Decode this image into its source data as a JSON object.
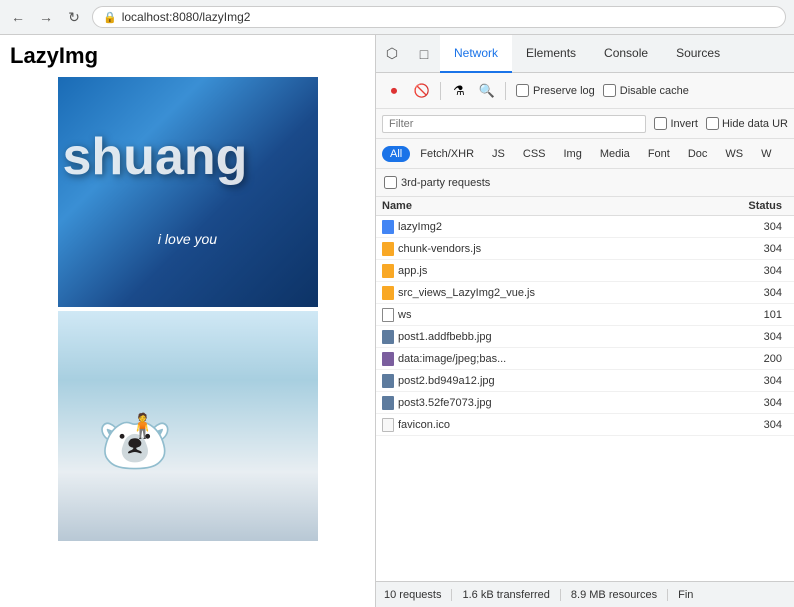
{
  "browser": {
    "back_label": "←",
    "forward_label": "→",
    "reload_label": "↻",
    "address": "localhost:8080/lazyImg2",
    "lock_icon": "🔒"
  },
  "page": {
    "title": "LazyImg",
    "img1_text": "shuang",
    "img1_sub": "i love you"
  },
  "devtools": {
    "tabs": [
      {
        "label": "Network",
        "active": true
      },
      {
        "label": "Elements",
        "active": false
      },
      {
        "label": "Console",
        "active": false
      },
      {
        "label": "Sources",
        "active": false
      }
    ],
    "toolbar": {
      "preserve_log_label": "Preserve log",
      "disable_cache_label": "Disable cache"
    },
    "filter": {
      "placeholder": "Filter",
      "invert_label": "Invert",
      "hide_data_url_label": "Hide data UR"
    },
    "type_filters": [
      {
        "label": "All",
        "active": true
      },
      {
        "label": "Fetch/XHR",
        "active": false
      },
      {
        "label": "JS",
        "active": false
      },
      {
        "label": "CSS",
        "active": false
      },
      {
        "label": "Img",
        "active": false
      },
      {
        "label": "Media",
        "active": false
      },
      {
        "label": "Font",
        "active": false
      },
      {
        "label": "Doc",
        "active": false
      },
      {
        "label": "WS",
        "active": false
      },
      {
        "label": "W",
        "active": false
      }
    ],
    "third_party_label": "3rd-party requests",
    "table": {
      "col_name": "Name",
      "col_status": "Status",
      "rows": [
        {
          "name": "lazyImg2",
          "status": "304",
          "icon_type": "doc"
        },
        {
          "name": "chunk-vendors.js",
          "status": "304",
          "icon_type": "js"
        },
        {
          "name": "app.js",
          "status": "304",
          "icon_type": "js"
        },
        {
          "name": "src_views_LazyImg2_vue.js",
          "status": "304",
          "icon_type": "js"
        },
        {
          "name": "ws",
          "status": "101",
          "icon_type": "ws"
        },
        {
          "name": "post1.addfbebb.jpg",
          "status": "304",
          "icon_type": "img"
        },
        {
          "name": "data:image/jpeg;bas...",
          "status": "200",
          "icon_type": "data-img"
        },
        {
          "name": "post2.bd949a12.jpg",
          "status": "304",
          "icon_type": "img"
        },
        {
          "name": "post3.52fe7073.jpg",
          "status": "304",
          "icon_type": "img"
        },
        {
          "name": "favicon.ico",
          "status": "304",
          "icon_type": "favicon"
        }
      ]
    },
    "status_bar": {
      "requests": "10 requests",
      "transferred": "1.6 kB transferred",
      "resources": "8.9 MB resources",
      "finish": "Fin"
    }
  }
}
